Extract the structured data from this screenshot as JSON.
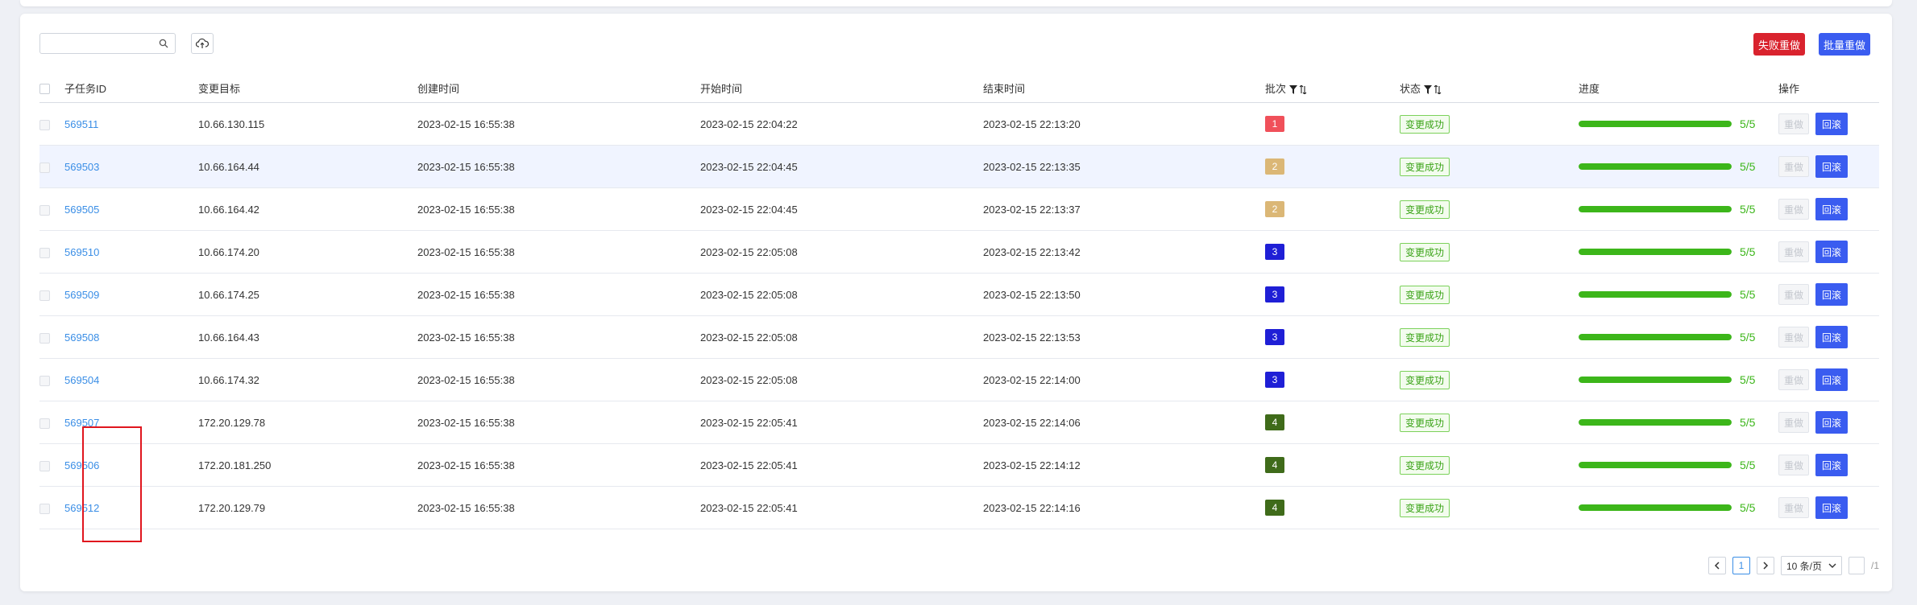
{
  "toolbar": {
    "search_value": "",
    "search_placeholder": "",
    "fail_redo_label": "失败重做",
    "batch_redo_label": "批量重做"
  },
  "table": {
    "headers": {
      "subtask_id": "子任务ID",
      "target": "变更目标",
      "created": "创建时间",
      "start": "开始时间",
      "end": "结束时间",
      "batch": "批次",
      "status": "状态",
      "progress": "进度",
      "action": "操作"
    },
    "rows": [
      {
        "id": "569511",
        "target": "10.66.130.115",
        "created": "2023-02-15 16:55:38",
        "start": "2023-02-15 22:04:22",
        "end": "2023-02-15 22:13:20",
        "batch": "1",
        "status": "变更成功",
        "progress": "5/5",
        "progress_fraction": 1,
        "redo": "重做",
        "rollback": "回滚"
      },
      {
        "id": "569503",
        "target": "10.66.164.44",
        "created": "2023-02-15 16:55:38",
        "start": "2023-02-15 22:04:45",
        "end": "2023-02-15 22:13:35",
        "batch": "2",
        "status": "变更成功",
        "progress": "5/5",
        "progress_fraction": 1,
        "redo": "重做",
        "rollback": "回滚"
      },
      {
        "id": "569505",
        "target": "10.66.164.42",
        "created": "2023-02-15 16:55:38",
        "start": "2023-02-15 22:04:45",
        "end": "2023-02-15 22:13:37",
        "batch": "2",
        "status": "变更成功",
        "progress": "5/5",
        "progress_fraction": 1,
        "redo": "重做",
        "rollback": "回滚"
      },
      {
        "id": "569510",
        "target": "10.66.174.20",
        "created": "2023-02-15 16:55:38",
        "start": "2023-02-15 22:05:08",
        "end": "2023-02-15 22:13:42",
        "batch": "3",
        "status": "变更成功",
        "progress": "5/5",
        "progress_fraction": 1,
        "redo": "重做",
        "rollback": "回滚"
      },
      {
        "id": "569509",
        "target": "10.66.174.25",
        "created": "2023-02-15 16:55:38",
        "start": "2023-02-15 22:05:08",
        "end": "2023-02-15 22:13:50",
        "batch": "3",
        "status": "变更成功",
        "progress": "5/5",
        "progress_fraction": 1,
        "redo": "重做",
        "rollback": "回滚"
      },
      {
        "id": "569508",
        "target": "10.66.164.43",
        "created": "2023-02-15 16:55:38",
        "start": "2023-02-15 22:05:08",
        "end": "2023-02-15 22:13:53",
        "batch": "3",
        "status": "变更成功",
        "progress": "5/5",
        "progress_fraction": 1,
        "redo": "重做",
        "rollback": "回滚"
      },
      {
        "id": "569504",
        "target": "10.66.174.32",
        "created": "2023-02-15 16:55:38",
        "start": "2023-02-15 22:05:08",
        "end": "2023-02-15 22:14:00",
        "batch": "3",
        "status": "变更成功",
        "progress": "5/5",
        "progress_fraction": 1,
        "redo": "重做",
        "rollback": "回滚"
      },
      {
        "id": "569507",
        "target": "172.20.129.78",
        "created": "2023-02-15 16:55:38",
        "start": "2023-02-15 22:05:41",
        "end": "2023-02-15 22:14:06",
        "batch": "4",
        "status": "变更成功",
        "progress": "5/5",
        "progress_fraction": 1,
        "redo": "重做",
        "rollback": "回滚"
      },
      {
        "id": "569506",
        "target": "172.20.181.250",
        "created": "2023-02-15 16:55:38",
        "start": "2023-02-15 22:05:41",
        "end": "2023-02-15 22:14:12",
        "batch": "4",
        "status": "变更成功",
        "progress": "5/5",
        "progress_fraction": 1,
        "redo": "重做",
        "rollback": "回滚"
      },
      {
        "id": "569512",
        "target": "172.20.129.79",
        "created": "2023-02-15 16:55:38",
        "start": "2023-02-15 22:05:41",
        "end": "2023-02-15 22:14:16",
        "batch": "4",
        "status": "变更成功",
        "progress": "5/5",
        "progress_fraction": 1,
        "redo": "重做",
        "rollback": "回滚"
      }
    ]
  },
  "batch_colors": {
    "1": "#f0505a",
    "2": "#dbb776",
    "3": "#1f1fd6",
    "4": "#3f6b1a"
  },
  "colors": {
    "accent": "#3a5cf0",
    "danger": "#d9232e",
    "success": "#3cb61a",
    "link": "#3a8ee6"
  },
  "pagination": {
    "current_page": "1",
    "page_size": "10 条/页",
    "total_suffix": "/1"
  }
}
